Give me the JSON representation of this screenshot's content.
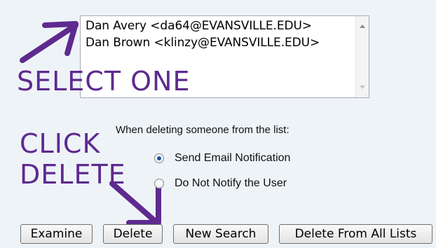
{
  "listbox": {
    "options": [
      "Dan Avery <da64@EVANSVILLE.EDU>",
      "Dan Brown <klinzy@EVANSVILLE.EDU>"
    ]
  },
  "annotations": {
    "select_one": "SELECT ONE",
    "click_delete_line1": "CLICK",
    "click_delete_line2": "DELETE",
    "color": "#5e2a8f"
  },
  "delete_options": {
    "instruction": "When deleting someone from the list:",
    "radios": [
      {
        "label": "Send Email Notification",
        "checked": true
      },
      {
        "label": "Do Not Notify the User",
        "checked": false
      }
    ]
  },
  "buttons": {
    "examine": "Examine",
    "delete": "Delete",
    "new_search": "New Search",
    "delete_all": "Delete From All Lists"
  }
}
